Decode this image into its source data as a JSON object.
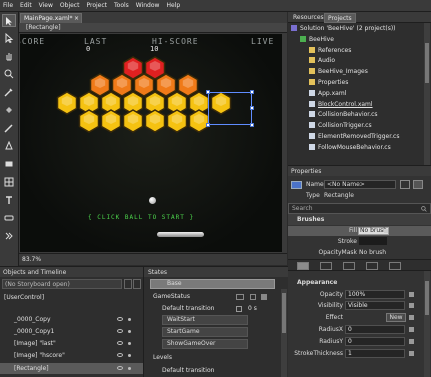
{
  "menu": [
    "File",
    "Edit",
    "View",
    "Object",
    "Project",
    "Tools",
    "Window",
    "Help"
  ],
  "document": {
    "tab_label": "MainPage.xaml*",
    "tab_close": "×",
    "breadcrumb": "[Rectangle]",
    "zoom": "83.7%"
  },
  "game": {
    "score_label": "SCORE",
    "last_label": "LAST",
    "last_value": "0",
    "hiscore_label": "HI-SCORE",
    "hiscore_value": "10",
    "lives_label": "LIVE",
    "click_text": "{ CLICK BALL TO START }"
  },
  "right_tabs": [
    "Resources",
    "Projects"
  ],
  "projects": {
    "items": [
      {
        "label": "Solution 'BeeHive' (2 project(s))",
        "icon": "solution-icon",
        "indent": 0
      },
      {
        "label": "BeeHive",
        "icon": "project-icon",
        "indent": 1
      },
      {
        "label": "References",
        "icon": "folder-icon",
        "indent": 2
      },
      {
        "label": "Audio",
        "icon": "folder-icon",
        "indent": 2
      },
      {
        "label": "BeeHive_Images",
        "icon": "folder-icon",
        "indent": 2
      },
      {
        "label": "Properties",
        "icon": "folder-icon",
        "indent": 2
      },
      {
        "label": "App.xaml",
        "icon": "file-icon",
        "indent": 2
      },
      {
        "label": "BlockControl.xaml",
        "icon": "file-icon",
        "indent": 2
      },
      {
        "label": "CollisionBehavior.cs",
        "icon": "file-icon",
        "indent": 2
      },
      {
        "label": "CollisionTrigger.cs",
        "icon": "file-icon",
        "indent": 2
      },
      {
        "label": "ElementRemovedTrigger.cs",
        "icon": "file-icon",
        "indent": 2
      },
      {
        "label": "FollowMouseBehavior.cs",
        "icon": "file-icon",
        "indent": 2
      }
    ]
  },
  "properties": {
    "header": "Properties",
    "name_label": "Name",
    "name_value": "<No Name>",
    "type_label": "Type",
    "type_value": "Rectangle",
    "search_placeholder": "Search",
    "brushes_header": "Brushes",
    "fill_label": "Fill",
    "fill_value": "No brush",
    "stroke_label": "Stroke",
    "opacitymask_label": "OpacityMask",
    "opacitymask_value": "No brush",
    "appearance_header": "Appearance",
    "opacity_label": "Opacity",
    "opacity_value": "100%",
    "visibility_label": "Visibility",
    "visibility_value": "Visible",
    "effect_label": "Effect",
    "effect_button": "New",
    "radiusx_label": "RadiusX",
    "radiusx_value": "0",
    "radiusy_label": "RadiusY",
    "radiusy_value": "0",
    "strokethickness_label": "StrokeThickness",
    "strokethickness_value": "1"
  },
  "objects": {
    "header": "Objects and Timeline",
    "storyboard": "(No Storyboard open)",
    "rows": [
      {
        "label": "[UserControl]",
        "indent": 0
      },
      {
        "label": "_0000_Copy",
        "indent": 1
      },
      {
        "label": "_0000_Copy1",
        "indent": 1
      },
      {
        "label": "[Image] \"last\"",
        "indent": 1
      },
      {
        "label": "[Image] \"hscore\"",
        "indent": 1
      },
      {
        "label": "[Rectangle]",
        "indent": 1
      }
    ]
  },
  "states": {
    "header": "States",
    "base": "Base",
    "group1": "GameStatus",
    "default_transition": "Default transition",
    "duration": "0 s",
    "group1_states": [
      "WaitStart",
      "StartGame",
      "ShowGameOver"
    ],
    "group2": "Levels",
    "default_transition2": "Default transition"
  },
  "colors": {
    "hex_red": "#e02020",
    "hex_orange": "#f07a18",
    "hex_yellow": "#f5c211",
    "selection": "#5f8cff",
    "text_green": "#4cd44c"
  }
}
